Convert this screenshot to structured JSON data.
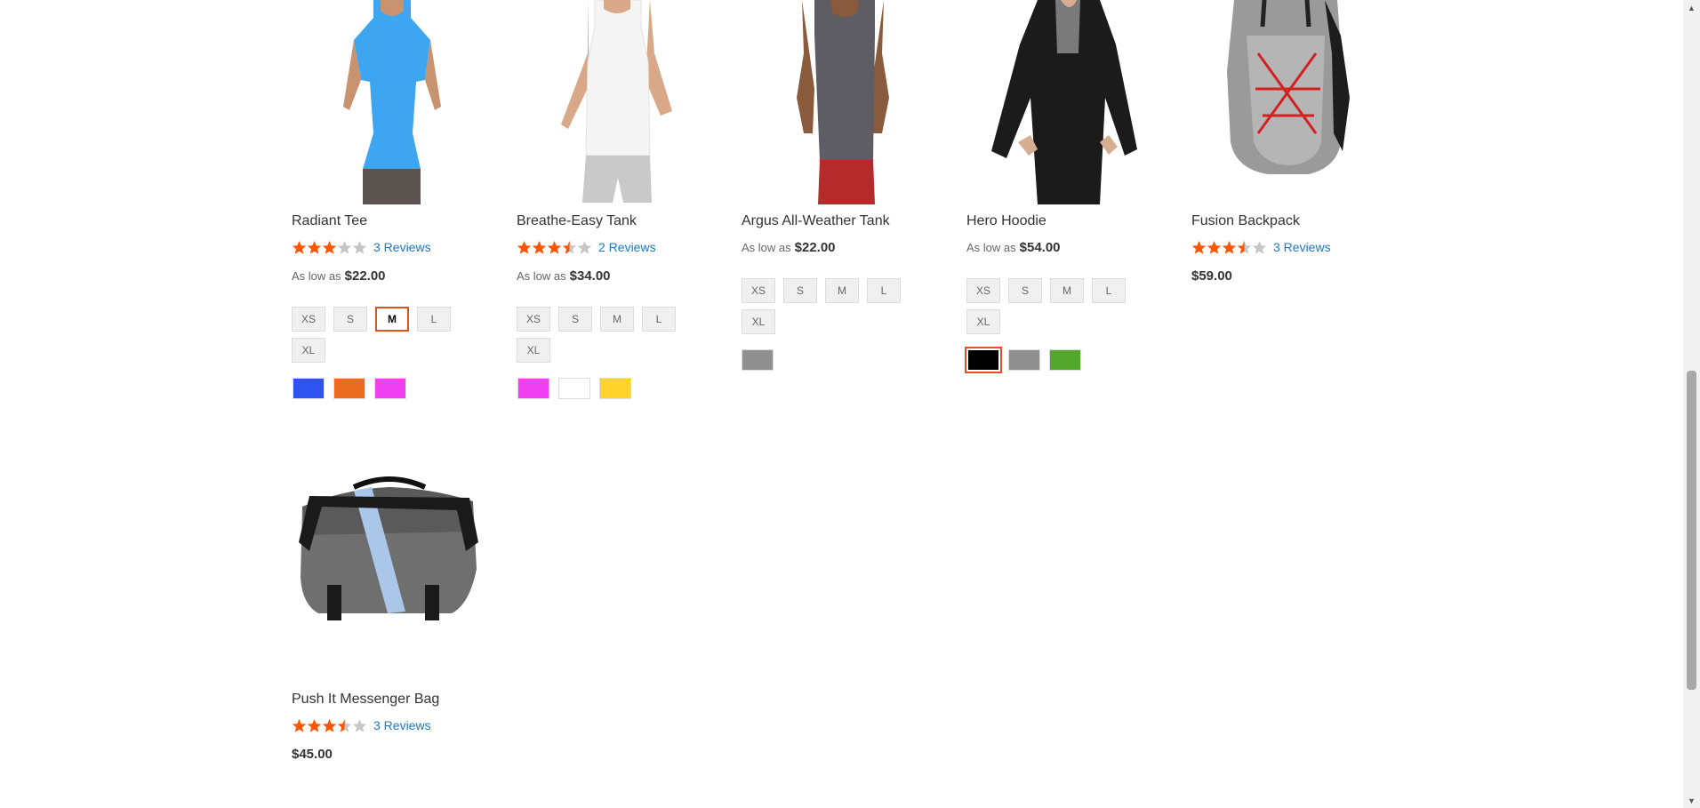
{
  "products": [
    {
      "name": "Radiant Tee",
      "rating": 3,
      "reviews": "3 Reviews",
      "aslow": "As low as",
      "price": "$22.00",
      "sizes": [
        "XS",
        "S",
        "M",
        "L",
        "XL"
      ],
      "selected_size": "M",
      "colors": [
        "#2f53f0",
        "#eb6c1e",
        "#ef3ff0"
      ],
      "selected_color": -1
    },
    {
      "name": "Breathe-Easy Tank",
      "rating": 3.5,
      "reviews": "2 Reviews",
      "aslow": "As low as",
      "price": "$34.00",
      "sizes": [
        "XS",
        "S",
        "M",
        "L",
        "XL"
      ],
      "selected_size": "",
      "colors": [
        "#ef3ff0",
        "#ffffff",
        "#ffd42a"
      ],
      "selected_color": -1
    },
    {
      "name": "Argus All-Weather Tank",
      "rating": 0,
      "reviews": "",
      "aslow": "As low as",
      "price": "$22.00",
      "sizes": [
        "XS",
        "S",
        "M",
        "L",
        "XL"
      ],
      "selected_size": "",
      "colors": [
        "#8f8f8f"
      ],
      "selected_color": -1
    },
    {
      "name": "Hero Hoodie",
      "rating": 0,
      "reviews": "",
      "aslow": "As low as",
      "price": "$54.00",
      "sizes": [
        "XS",
        "S",
        "M",
        "L",
        "XL"
      ],
      "selected_size": "",
      "colors": [
        "#000000",
        "#8f8f8f",
        "#53a82c"
      ],
      "selected_color": 0
    },
    {
      "name": "Fusion Backpack",
      "rating": 3.5,
      "reviews": "3 Reviews",
      "aslow": "",
      "price": "$59.00",
      "sizes": [],
      "selected_size": "",
      "colors": [],
      "selected_color": -1
    },
    {
      "name": "Push It Messenger Bag",
      "rating": 3.5,
      "reviews": "3 Reviews",
      "aslow": "",
      "price": "$45.00",
      "sizes": [],
      "selected_size": "",
      "colors": [],
      "selected_color": -1
    }
  ],
  "colors": {
    "star_on": "#ff5501",
    "star_off": "#c7c7c7",
    "link": "#1979c3",
    "accent": "#e0541c"
  }
}
